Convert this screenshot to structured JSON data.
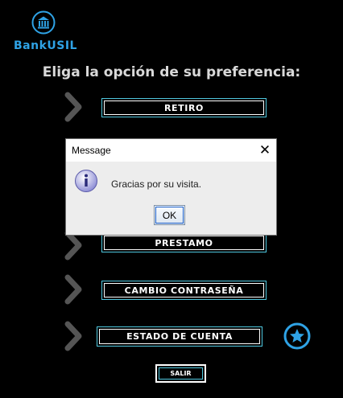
{
  "app": {
    "brand": "BankUSIL",
    "heading": "Eliga la opción de su preferencia:",
    "logo_icon": "bank-building-icon"
  },
  "menu": {
    "retiro": "RETIRO",
    "prestamo": "PRESTAMO",
    "cambio_contrasena": "CAMBIO CONTRASEÑA",
    "estado_cuenta": "ESTADO DE CUENTA"
  },
  "salir_label": "SALIR",
  "favorite_icon": "star-icon",
  "dialog": {
    "title": "Message",
    "message": "Gracias por su visita.",
    "ok_label": "OK",
    "close_label": "✕",
    "icon": "info-icon"
  },
  "colors": {
    "background": "#000000",
    "brand": "#2fa3e6",
    "button_border": "#4fc7de",
    "chevron": "#555555",
    "star": "#2fa3e6"
  }
}
